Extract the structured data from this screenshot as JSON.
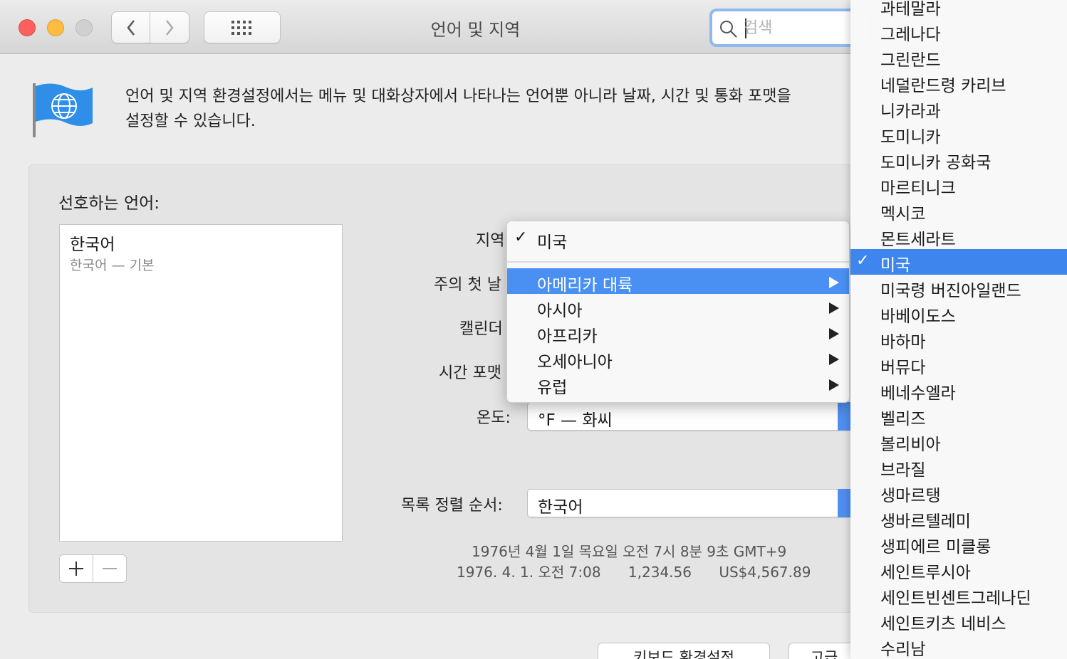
{
  "window": {
    "title": "언어 및 지역"
  },
  "search": {
    "placeholder": "검색",
    "icon": "search-icon"
  },
  "header": {
    "line1": "언어 및 지역 환경설정에서는 메뉴 및 대화상자에서 나타나는 언어뿐 아니라 날짜, 시간 및 통화 포맷을",
    "line2": "설정할 수 있습니다.",
    "icon": "globe-flag-icon"
  },
  "preferred": {
    "label": "선호하는 언어:",
    "languages": [
      {
        "name": "한국어",
        "sub": "한국어 — 기본"
      }
    ],
    "add_label": "+",
    "remove_label": "—"
  },
  "fields": {
    "region_label": "지역",
    "first_day_label": "주의 첫 날",
    "calendar_label": "캘린더",
    "time_format_label": "시간 포맷",
    "temperature_label": "온도:",
    "temperature_value": "°F — 화씨",
    "sort_label": "목록 정렬 순서:",
    "sort_value": "한국어"
  },
  "samples": {
    "long_date": "1976년 4월 1일 목요일 오전 7시 8분 9초 GMT+9",
    "short_date": "1976. 4. 1. 오전 7:08",
    "number": "1,234.56",
    "currency": "US$4,567.89"
  },
  "buttons": {
    "keyboard": "키보드 환경설정",
    "advanced": "고급"
  },
  "region_menu": {
    "current": "미국",
    "items": [
      "아메리카 대륙",
      "아시아",
      "아프리카",
      "오세아니아",
      "유럽"
    ],
    "selected_index": 0
  },
  "country_menu": {
    "items": [
      "과테말라",
      "그레나다",
      "그린란드",
      "네덜란드령 카리브",
      "니카라과",
      "도미니카",
      "도미니카 공화국",
      "마르티니크",
      "멕시코",
      "몬트세라트",
      "미국",
      "미국령 버진아일랜드",
      "바베이도스",
      "바하마",
      "버뮤다",
      "베네수엘라",
      "벨리즈",
      "볼리비아",
      "브라질",
      "생마르탱",
      "생바르텔레미",
      "생피에르 미클롱",
      "세인트루시아",
      "세인트빈센트그레나딘",
      "세인트키츠 네비스",
      "수리남"
    ],
    "selected": "미국"
  },
  "colors": {
    "accent": "#3e86ee",
    "highlight": "#4a90f2"
  }
}
